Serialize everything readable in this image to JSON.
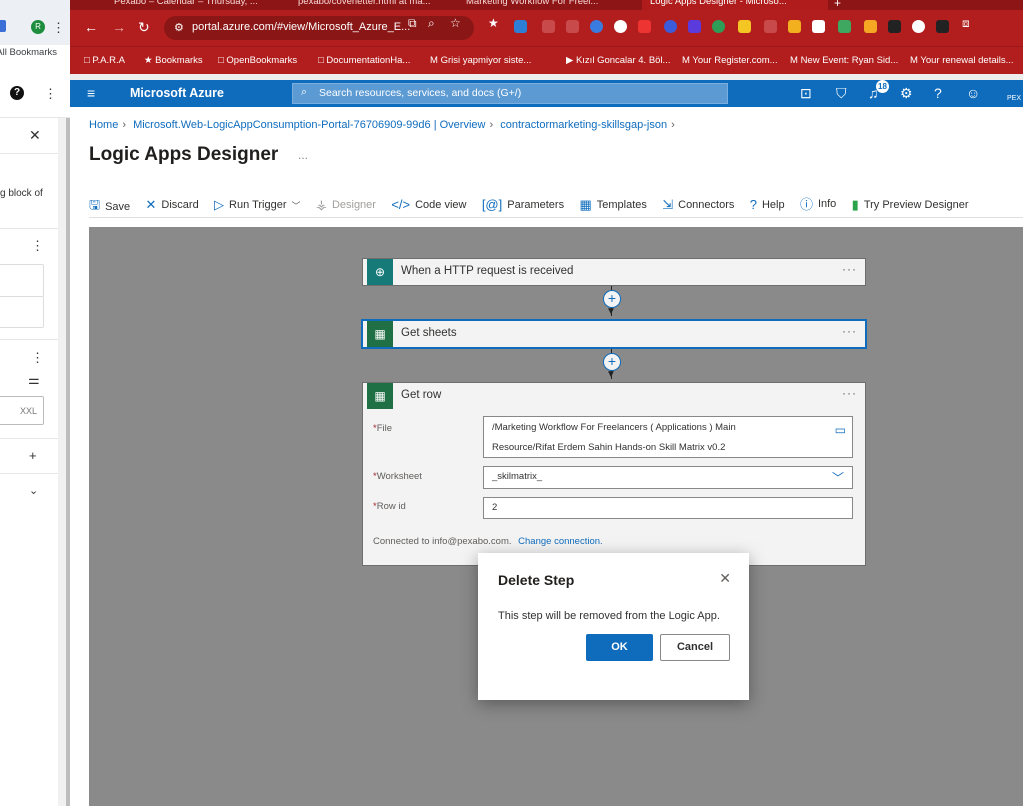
{
  "browser": {
    "tabs": [
      {
        "label": "Pexabo – Calendar – Thursday, ..."
      },
      {
        "label": "pexabo/coverletter.html at ma..."
      },
      {
        "label": "Marketing Workflow For Freel..."
      },
      {
        "label": "Logic Apps Designer - Microso..."
      }
    ],
    "url": "portal.azure.com/#view/Microsoft_Azure_E...",
    "bookmarks": [
      {
        "label": "P.A.R.A"
      },
      {
        "label": "Bookmarks"
      },
      {
        "label": "OpenBookmarks"
      },
      {
        "label": "DocumentationHa..."
      },
      {
        "label": "Grisi yapmiyor siste..."
      },
      {
        "label": "Kızıl Goncalar 4. Böl..."
      },
      {
        "label": "Your Register.com..."
      },
      {
        "label": "New Event: Ryan Sid..."
      },
      {
        "label": "Your renewal details..."
      }
    ],
    "notification_count": "18"
  },
  "left_window": {
    "all_bookmarks": "All Bookmarks",
    "snippet": "g block of",
    "size_value": "XXL"
  },
  "azure": {
    "brand": "Microsoft Azure",
    "search_placeholder": "Search resources, services, and docs (G+/)",
    "user_short": "PEX"
  },
  "breadcrumb": {
    "home": "Home",
    "resource": "Microsoft.Web-LogicAppConsumption-Portal-76706909-99d6 | Overview",
    "workflow": "contractormarketing-skillsgap-json"
  },
  "page": {
    "title": "Logic Apps Designer",
    "more": "..."
  },
  "commands": {
    "save": "Save",
    "discard": "Discard",
    "run_trigger": "Run Trigger",
    "designer": "Designer",
    "code_view": "Code view",
    "parameters": "Parameters",
    "templates": "Templates",
    "connectors": "Connectors",
    "help": "Help",
    "info": "Info",
    "preview": "Try Preview Designer"
  },
  "steps": {
    "trigger": {
      "title": "When a HTTP request is received"
    },
    "get_sheets": {
      "title": "Get sheets"
    },
    "get_row": {
      "title": "Get row",
      "file_label": "File",
      "file_value_1": "/Marketing Workflow For Freelancers ( Applications ) Main",
      "file_value_2": "Resource/Rifat Erdem Sahin Hands-on Skill Matrix v0.2",
      "worksheet_label": "Worksheet",
      "worksheet_value": "_skilmatrix_",
      "rowid_label": "Row id",
      "rowid_value": "2",
      "connected_text": "Connected to info@pexabo.com.",
      "change_connection": "Change connection."
    }
  },
  "dialog": {
    "title": "Delete Step",
    "message": "This step will be removed from the Logic App.",
    "ok": "OK",
    "cancel": "Cancel"
  },
  "colors": {
    "azure_blue": "#0f6cbd",
    "browser_red": "#b21e1e",
    "canvas_gray": "#8a8a8a",
    "http_teal": "#167a78",
    "sheets_green": "#1f7044"
  }
}
